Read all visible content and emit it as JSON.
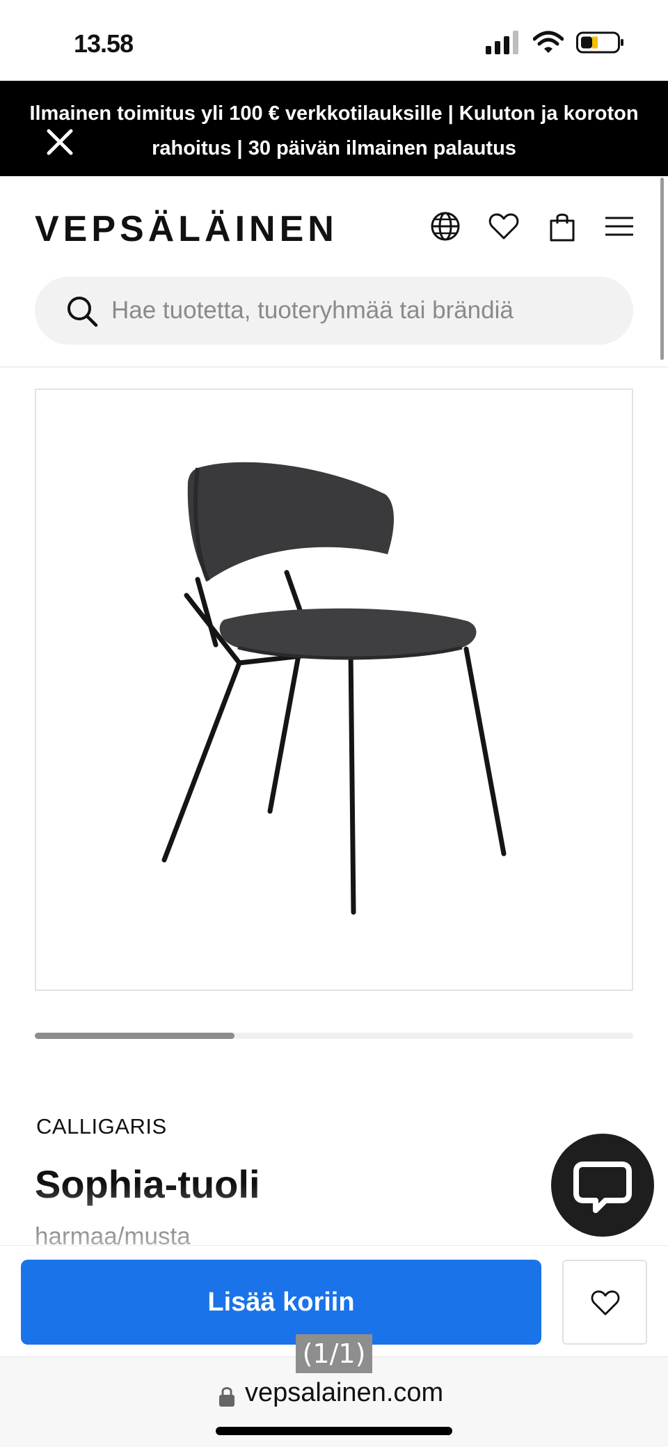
{
  "status_bar": {
    "time": "13.58"
  },
  "promo": {
    "text": "Ilmainen toimitus yli 100 € verkkotilauksille | Kuluton ja koroton rahoitus | 30 päivän ilmainen palautus"
  },
  "header": {
    "logo": "VEPSÄLÄINEN",
    "icons": [
      "globe-icon",
      "heart-icon",
      "shopping-bag-icon",
      "menu-icon"
    ]
  },
  "search": {
    "placeholder": "Hae tuotetta, tuoteryhmää tai brändiä"
  },
  "gallery": {
    "position": 1,
    "count": 3
  },
  "product": {
    "brand": "CALLIGARIS",
    "title": "Sophia-tuoli",
    "variant": "harmaa/musta"
  },
  "actions": {
    "add_to_cart": "Lisää koriin"
  },
  "overlay": {
    "counter": "(1/1)"
  },
  "browser": {
    "url": "vepsalainen.com"
  },
  "colors": {
    "primary_button": "#1a73e8",
    "banner_bg": "#000000",
    "chat_bg": "#1e1e1e"
  }
}
